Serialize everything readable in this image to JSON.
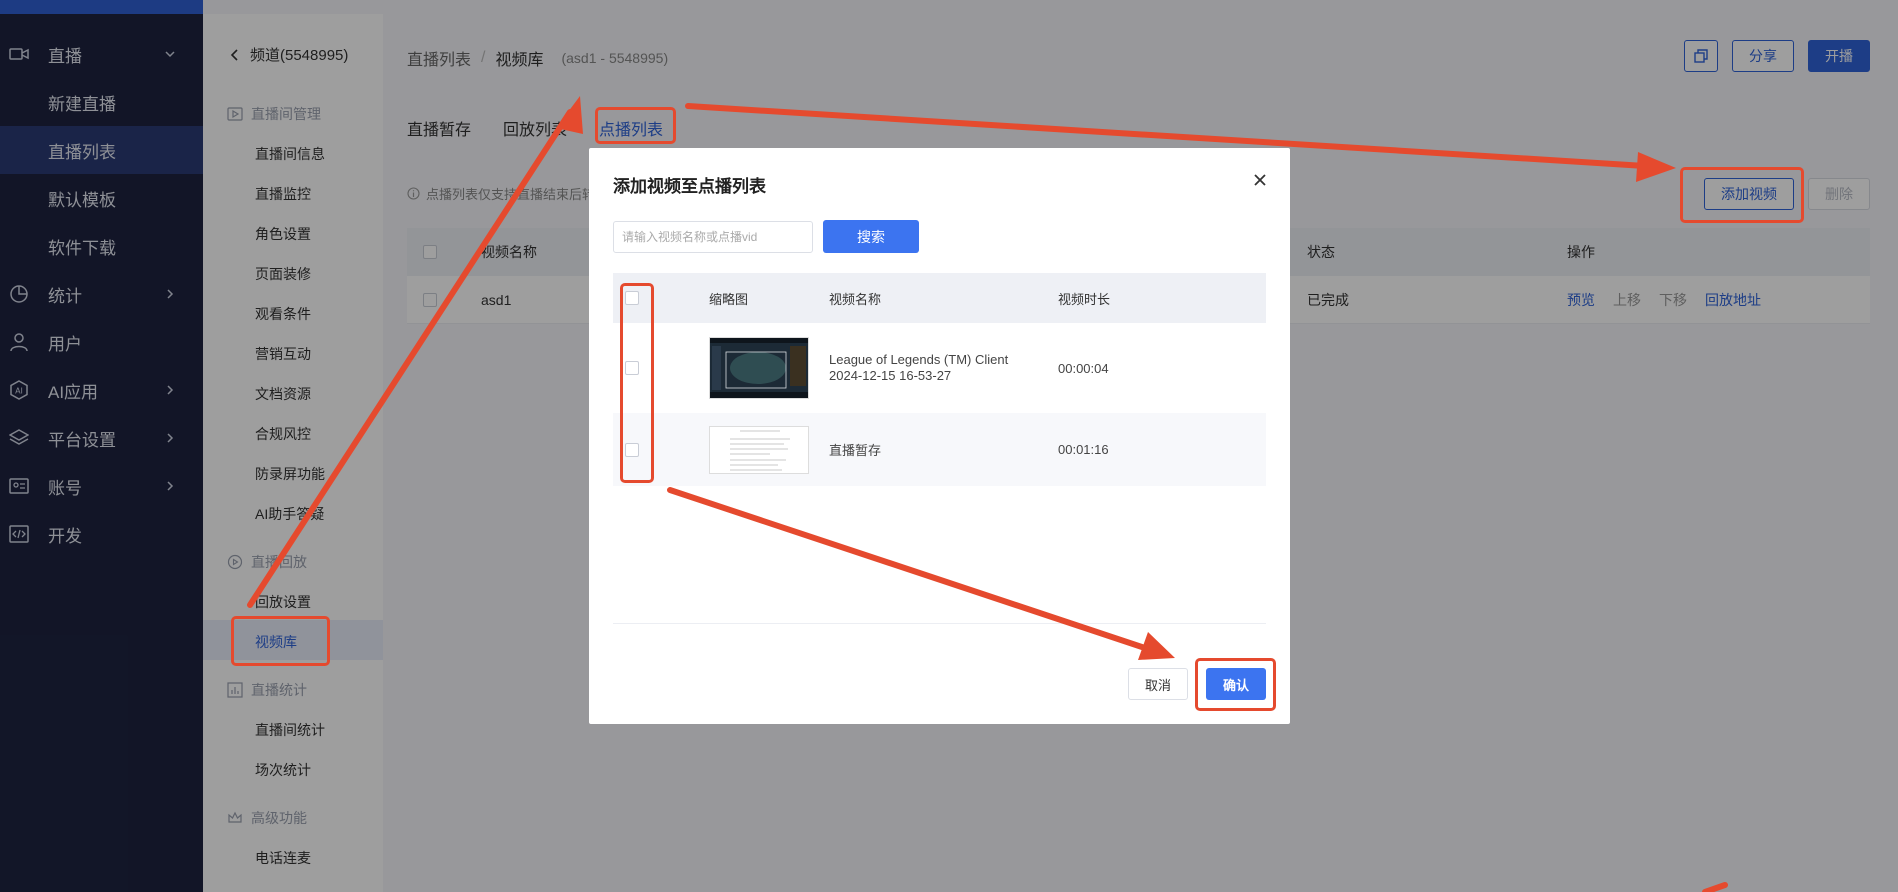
{
  "sidebar": {
    "items": [
      {
        "label": "直播",
        "icon": "video-camera-icon",
        "expanded": true
      },
      {
        "label": "新建直播"
      },
      {
        "label": "直播列表",
        "active": true
      },
      {
        "label": "默认模板"
      },
      {
        "label": "软件下载"
      },
      {
        "label": "统计",
        "icon": "pie-chart-icon"
      },
      {
        "label": "用户",
        "icon": "user-icon"
      },
      {
        "label": "AI应用",
        "icon": "ai-icon"
      },
      {
        "label": "平台设置",
        "icon": "layers-icon"
      },
      {
        "label": "账号",
        "icon": "id-card-icon"
      },
      {
        "label": "开发",
        "icon": "code-icon"
      }
    ]
  },
  "subnav": {
    "back_label": "频道(5548995)",
    "groups": [
      {
        "label": "直播间管理",
        "items": [
          "直播间信息",
          "直播监控",
          "角色设置",
          "页面装修",
          "观看条件",
          "营销互动",
          "文档资源",
          "合规风控",
          "防录屏功能",
          "AI助手答疑"
        ]
      },
      {
        "label": "直播回放",
        "items": [
          "回放设置",
          "视频库"
        ]
      },
      {
        "label": "直播统计",
        "items": [
          "直播间统计",
          "场次统计"
        ]
      },
      {
        "label": "高级功能",
        "items": [
          "电话连麦"
        ]
      }
    ]
  },
  "header": {
    "breadcrumb_root": "直播列表",
    "breadcrumb_sep": "/",
    "breadcrumb_current": "视频库",
    "breadcrumb_meta": "(asd1 - 5548995)",
    "share_label": "分享",
    "start_label": "开播"
  },
  "tabs": [
    "直播暂存",
    "回放列表",
    "点播列表"
  ],
  "notice_text": "点播列表仅支持直播结束后转存",
  "list_actions": {
    "add_label": "添加视频",
    "delete_label": "删除"
  },
  "table": {
    "headers": {
      "name": "视频名称",
      "status": "状态",
      "ops": "操作"
    },
    "rows": [
      {
        "name": "asd1",
        "status": "已完成",
        "ops": [
          "预览",
          "上移",
          "下移",
          "回放地址"
        ]
      }
    ]
  },
  "dialog": {
    "title": "添加视频至点播列表",
    "search_placeholder": "请输入视频名称或点播vid",
    "search_label": "搜索",
    "headers": {
      "thumb": "缩略图",
      "name": "视频名称",
      "duration": "视频时长"
    },
    "rows": [
      {
        "name": "League of Legends (TM) Client 2024-12-15 16-53-27",
        "duration": "00:00:04"
      },
      {
        "name": "直播暂存",
        "duration": "00:01:16"
      }
    ],
    "cancel_label": "取消",
    "confirm_label": "确认"
  },
  "annotation_color": "#e54a2e",
  "accent_color": "#2f63d9"
}
